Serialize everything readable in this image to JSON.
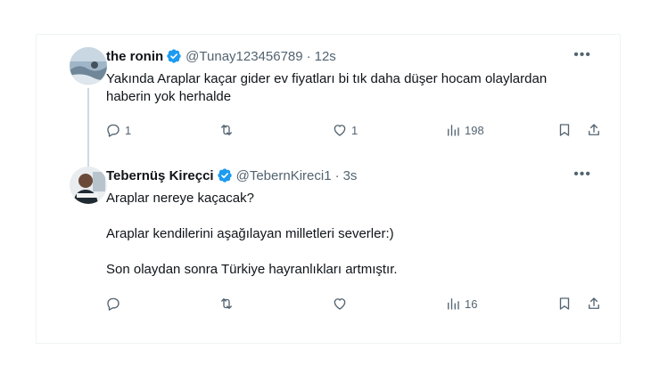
{
  "tweets": [
    {
      "name": "the ronin",
      "handle": "@Tunay123456789",
      "separator": "·",
      "time": "12s",
      "text_lines": [
        "Yakında Araplar kaçar gider ev fiyatları bi tık daha düşer hocam olaylardan",
        "haberin yok herhalde"
      ],
      "stats": {
        "replies": "1",
        "retweets": "",
        "likes": "1",
        "views": "198"
      }
    },
    {
      "name": "Tebernüş Kireçci",
      "handle": "@TebernKireci1",
      "separator": "·",
      "time": "3s",
      "text_lines": [
        "Araplar nereye kaçacak?",
        "Araplar kendilerini aşağılayan milletleri severler:)",
        "Son olaydan sonra Türkiye hayranlıkları artmıştır."
      ],
      "stats": {
        "replies": "",
        "retweets": "",
        "likes": "",
        "views": "16"
      }
    }
  ],
  "icons": {
    "verified": "verified-badge-icon",
    "more": "more-icon",
    "reply": "reply-icon",
    "retweet": "retweet-icon",
    "like": "heart-icon",
    "views": "views-icon",
    "bookmark": "bookmark-icon",
    "share": "share-icon"
  },
  "colors": {
    "verified": "#1d9bf0",
    "text": "#0f1419",
    "muted": "#536471"
  }
}
